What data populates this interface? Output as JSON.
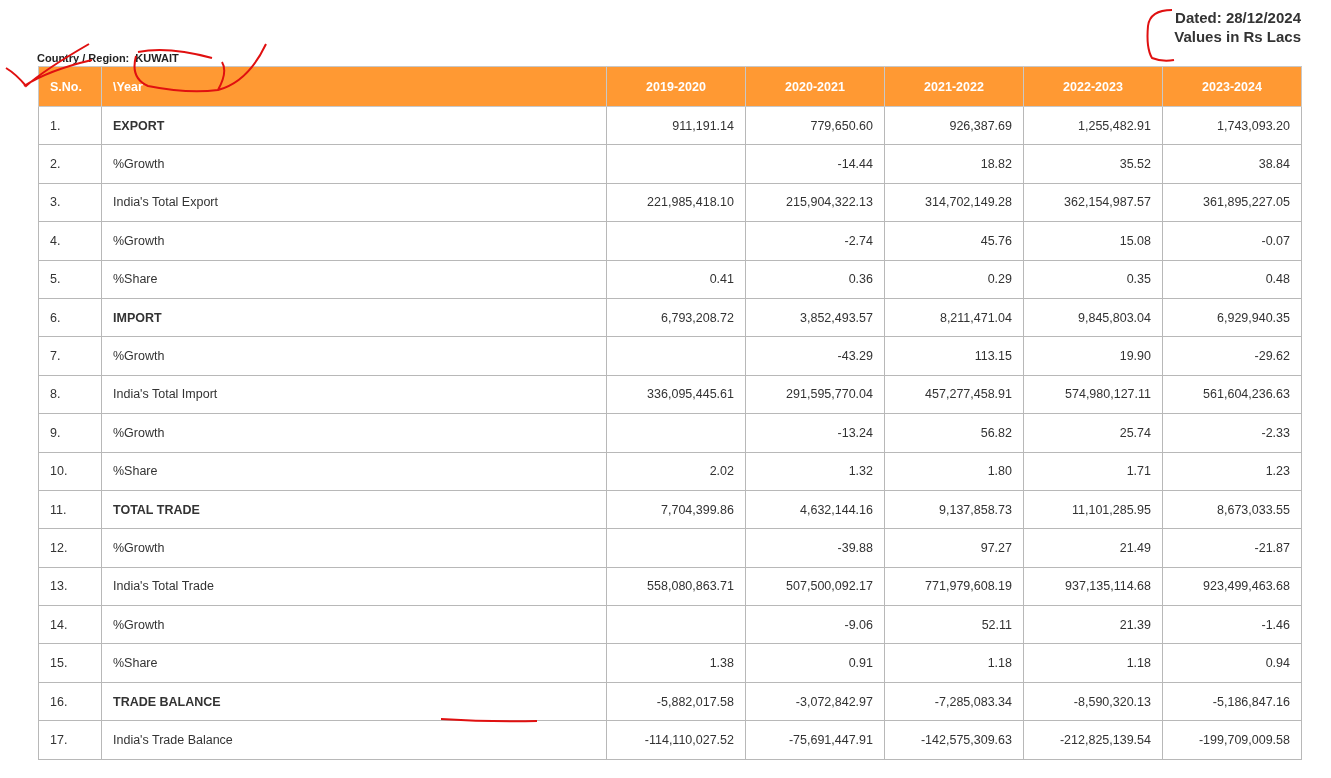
{
  "header": {
    "dated": "Dated: 28/12/2024",
    "units": "Values in Rs Lacs"
  },
  "region": {
    "label": "Country / Region:",
    "value": "KUWAIT"
  },
  "table": {
    "columns": [
      "S.No.",
      "\\Year",
      "2019-2020",
      "2020-2021",
      "2021-2022",
      "2022-2023",
      "2023-2024"
    ],
    "rows": [
      {
        "no": "1.",
        "label": "EXPORT",
        "kind": "total",
        "values": [
          "911,191.14",
          "779,650.60",
          "926,387.69",
          "1,255,482.91",
          "1,743,093.20"
        ]
      },
      {
        "no": "2.",
        "label": "%Growth",
        "kind": "item",
        "values": [
          "-14.44",
          "18.82",
          "35.52",
          "38.84"
        ]
      },
      {
        "no": "3.",
        "label": "India's Total Export",
        "kind": "item",
        "values": [
          "221,985,418.10",
          "215,904,322.13",
          "314,702,149.28",
          "362,154,987.57",
          "361,895,227.05"
        ]
      },
      {
        "no": "4.",
        "label": "%Growth",
        "kind": "item",
        "values": [
          "-2.74",
          "45.76",
          "15.08",
          "-0.07"
        ]
      },
      {
        "no": "5.",
        "label": "%Share",
        "kind": "item",
        "values": [
          "0.41",
          "0.36",
          "0.29",
          "0.35",
          "0.48"
        ]
      },
      {
        "no": "6.",
        "label": "IMPORT",
        "kind": "total",
        "values": [
          "6,793,208.72",
          "3,852,493.57",
          "8,211,471.04",
          "9,845,803.04",
          "6,929,940.35"
        ]
      },
      {
        "no": "7.",
        "label": "%Growth",
        "kind": "item",
        "values": [
          "-43.29",
          "113.15",
          "19.90",
          "-29.62"
        ]
      },
      {
        "no": "8.",
        "label": "India's Total Import",
        "kind": "item",
        "values": [
          "336,095,445.61",
          "291,595,770.04",
          "457,277,458.91",
          "574,980,127.11",
          "561,604,236.63"
        ]
      },
      {
        "no": "9.",
        "label": "%Growth",
        "kind": "item",
        "values": [
          "-13.24",
          "56.82",
          "25.74",
          "-2.33"
        ]
      },
      {
        "no": "10.",
        "label": "%Share",
        "kind": "item",
        "values": [
          "2.02",
          "1.32",
          "1.80",
          "1.71",
          "1.23"
        ]
      },
      {
        "no": "11.",
        "label": "TOTAL TRADE",
        "kind": "total",
        "values": [
          "7,704,399.86",
          "4,632,144.16",
          "9,137,858.73",
          "11,101,285.95",
          "8,673,033.55"
        ]
      },
      {
        "no": "12.",
        "label": "%Growth",
        "kind": "item",
        "values": [
          "-39.88",
          "97.27",
          "21.49",
          "-21.87"
        ]
      },
      {
        "no": "13.",
        "label": "India's Total Trade",
        "kind": "item",
        "values": [
          "558,080,863.71",
          "507,500,092.17",
          "771,979,608.19",
          "937,135,114.68",
          "923,499,463.68"
        ]
      },
      {
        "no": "14.",
        "label": "%Growth",
        "kind": "item",
        "values": [
          "-9.06",
          "52.11",
          "21.39",
          "-1.46"
        ]
      },
      {
        "no": "15.",
        "label": "%Share",
        "kind": "item",
        "values": [
          "1.38",
          "0.91",
          "1.18",
          "1.18",
          "0.94"
        ]
      },
      {
        "no": "16.",
        "label": "TRADE BALANCE",
        "kind": "total",
        "values": [
          "-5,882,017.58",
          "-3,072,842.97",
          "-7,285,083.34",
          "-8,590,320.13",
          "-5,186,847.16"
        ]
      },
      {
        "no": "17.",
        "label": "India's Trade Balance",
        "kind": "item",
        "values": [
          "-114,110,027.52",
          "-75,691,447.91",
          "-142,575,309.63",
          "-212,825,139.54",
          "-199,709,009.58"
        ]
      }
    ]
  }
}
